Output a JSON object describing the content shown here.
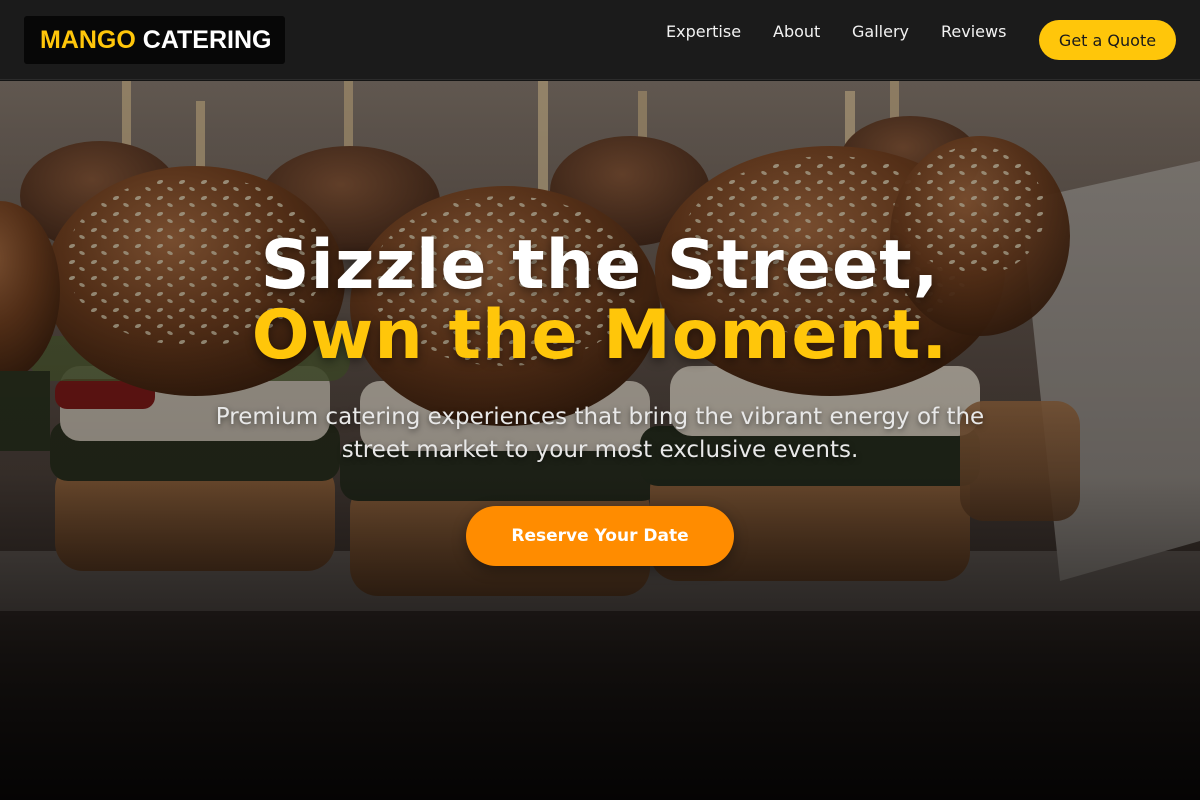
{
  "brand": {
    "accent": "MANGO",
    "name": "CATERING"
  },
  "nav": {
    "links": [
      {
        "label": "Expertise"
      },
      {
        "label": "About"
      },
      {
        "label": "Gallery"
      },
      {
        "label": "Reviews"
      }
    ],
    "cta_label": "Get a Quote"
  },
  "hero": {
    "title_line_1": "Sizzle the Street,",
    "title_line_2": "Own the Moment.",
    "subtitle": "Premium catering experiences that bring the vibrant energy of the street market to your most exclusive events.",
    "cta_label": "Reserve Your Date",
    "background_image": "sliders-on-skewers-photo"
  },
  "colors": {
    "accent_yellow": "#ffc60a",
    "cta_orange": "#ff8c00",
    "navbar_bg": "#1b1b1b"
  }
}
